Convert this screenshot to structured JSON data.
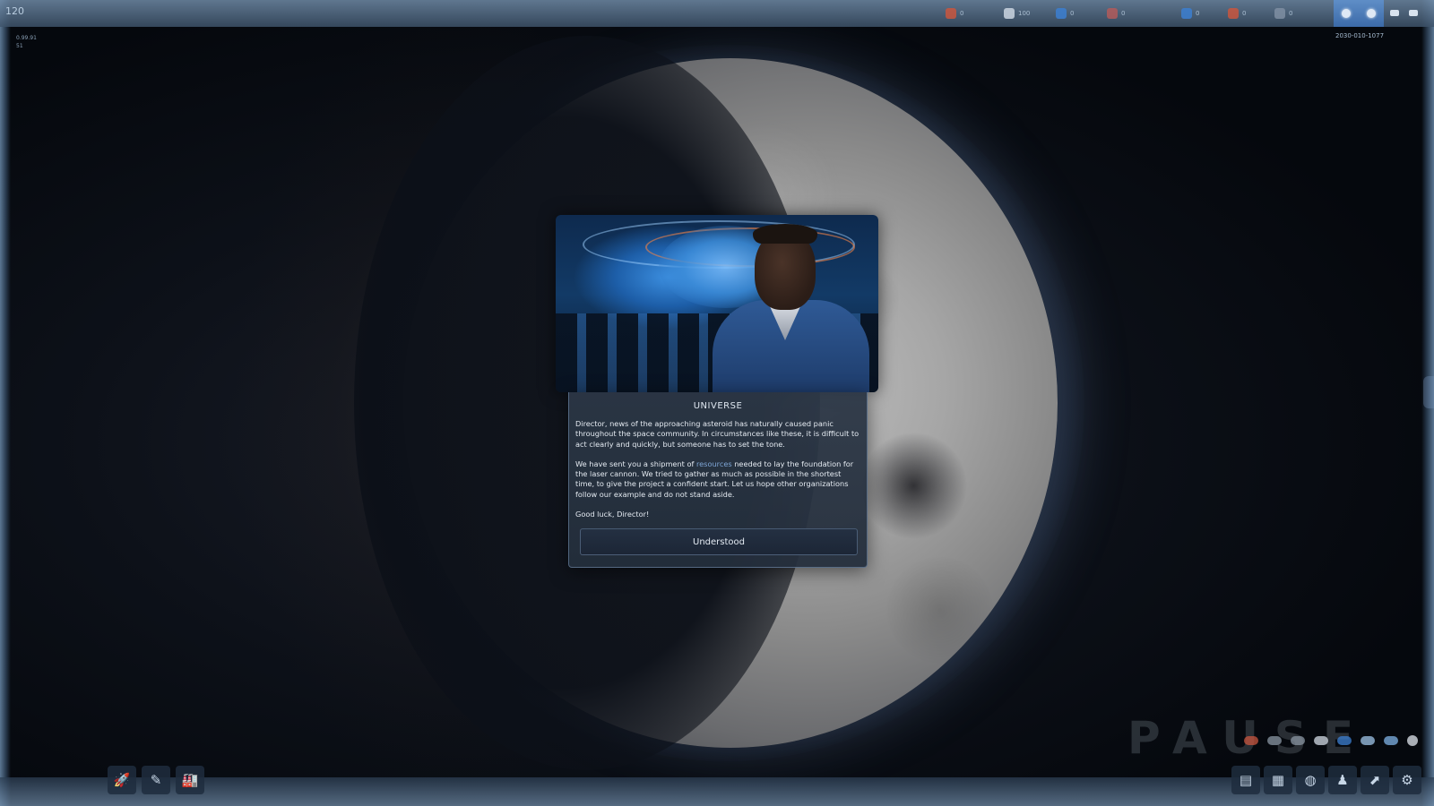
{
  "hud": {
    "fps": "120",
    "version_line1": "0.99.91",
    "version_line2": "51",
    "date": "2030-010-1077",
    "pause_text": "PAUSE"
  },
  "top_resources": [
    {
      "icon": "chat-icon",
      "value": "0",
      "color": "#c8563f"
    },
    {
      "icon": "pen-icon",
      "value": "100",
      "color": "#cbd5e1"
    },
    {
      "icon": "person-icon",
      "value": "0",
      "color": "#3c7fd1"
    },
    {
      "icon": "gear-icon",
      "value": "0",
      "color": "#b25b5b"
    },
    {
      "icon": "ship-icon",
      "value": "0",
      "color": "#3c7fd1"
    },
    {
      "icon": "fire-icon",
      "value": "0",
      "color": "#c8563f"
    },
    {
      "icon": "cloud-icon",
      "value": "0",
      "color": "#7f8fa3"
    }
  ],
  "dialog": {
    "title": "UNIVERSE",
    "para1": "Director, news of the approaching asteroid has naturally caused panic throughout the space community. In circumstances like these, it is difficult to act clearly and quickly, but someone has to set the tone.",
    "para2_before": "We have sent you a shipment of ",
    "para2_link": "resources",
    "para2_after": " needed to lay the foundation for the laser cannon. We tried to gather as much as possible in the shortest time, to give the project a confident start. Let us hope other organizations follow our example and do not stand aside.",
    "para3": "Good luck, Director!",
    "button_label": "Understood"
  },
  "bottom_left_buttons": [
    {
      "icon": "rocket-icon",
      "glyph": "🚀"
    },
    {
      "icon": "wrench-icon",
      "glyph": "✎"
    },
    {
      "icon": "factory-icon",
      "glyph": "🏭"
    }
  ],
  "bottom_right_buttons": [
    {
      "icon": "document-icon",
      "glyph": "▤"
    },
    {
      "icon": "building-icon",
      "glyph": "▦"
    },
    {
      "icon": "globe-icon",
      "glyph": "◍"
    },
    {
      "icon": "person-icon",
      "glyph": "♟"
    },
    {
      "icon": "arrow-icon",
      "glyph": "⬈"
    },
    {
      "icon": "settings-icon",
      "glyph": "⚙"
    }
  ],
  "colors": {
    "accent": "#5f8ec7",
    "link": "#7ea6d6",
    "dialog_bg": "#2c3746"
  }
}
